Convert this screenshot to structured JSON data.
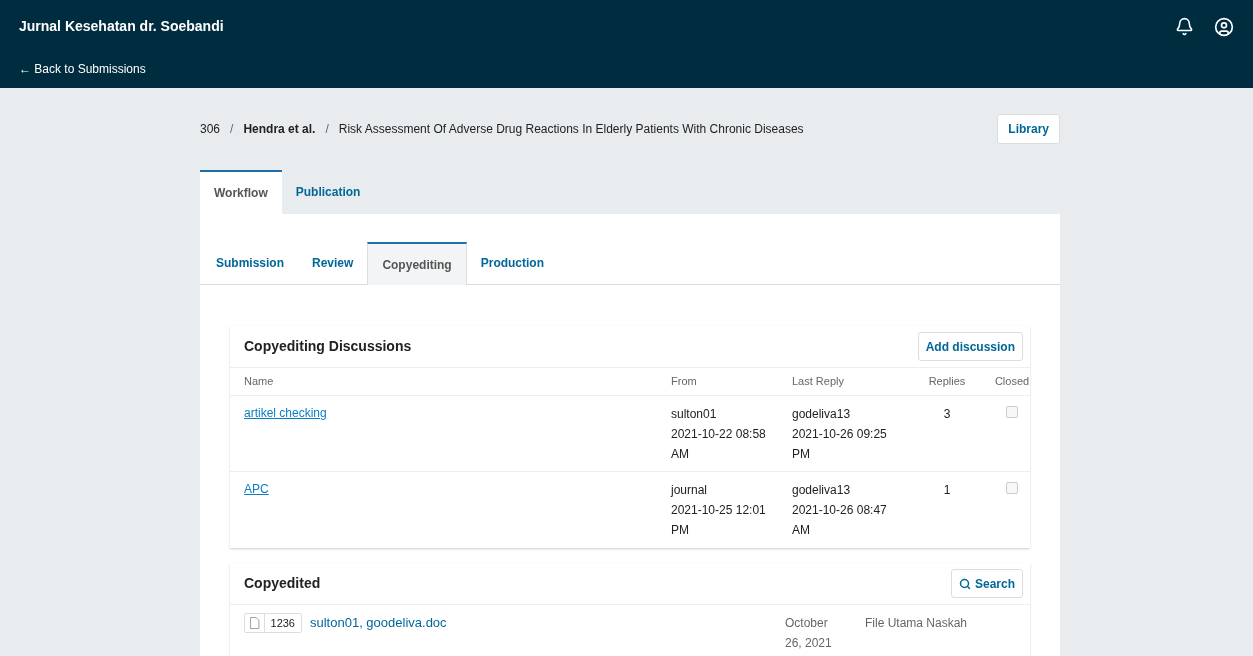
{
  "header": {
    "title": "Jurnal Kesehatan dr. Soebandi",
    "back_link": "← Back to Submissions"
  },
  "breadcrumb": {
    "id": "306",
    "separator": "/",
    "authors": "Hendra et al.",
    "title": "Risk Assessment Of Adverse Drug Reactions In Elderly Patients With Chronic Diseases"
  },
  "library_button": "Library",
  "main_tabs": [
    {
      "label": "Workflow",
      "selected": true
    },
    {
      "label": "Publication",
      "selected": false
    }
  ],
  "stage_tabs": [
    {
      "label": "Submission",
      "selected": false
    },
    {
      "label": "Review",
      "selected": false
    },
    {
      "label": "Copyediting",
      "selected": true
    },
    {
      "label": "Production",
      "selected": false
    }
  ],
  "discussions": {
    "title": "Copyediting Discussions",
    "button": "Add discussion",
    "columns": [
      "Name",
      "From",
      "Last Reply",
      "Replies",
      "Closed"
    ],
    "rows": [
      {
        "name": "artikel checking",
        "from": [
          "sulton01",
          "2021-10-22 08:58",
          "AM"
        ],
        "last_reply": [
          "godeliva13",
          "2021-10-26 09:25",
          "PM"
        ],
        "replies": "3",
        "closed": false
      },
      {
        "name": "APC",
        "from": [
          "journal",
          "2021-10-25 12:01",
          "PM"
        ],
        "last_reply": [
          "godeliva13",
          "2021-10-26 08:47",
          "AM"
        ],
        "replies": "1",
        "closed": false
      }
    ]
  },
  "copyedited": {
    "title": "Copyedited",
    "search_button": "Search",
    "files": [
      {
        "id": "1236",
        "name": "sulton01, goodeliva.doc",
        "date": [
          "October",
          "26, 2021"
        ],
        "type": "File Utama Naskah"
      }
    ]
  }
}
